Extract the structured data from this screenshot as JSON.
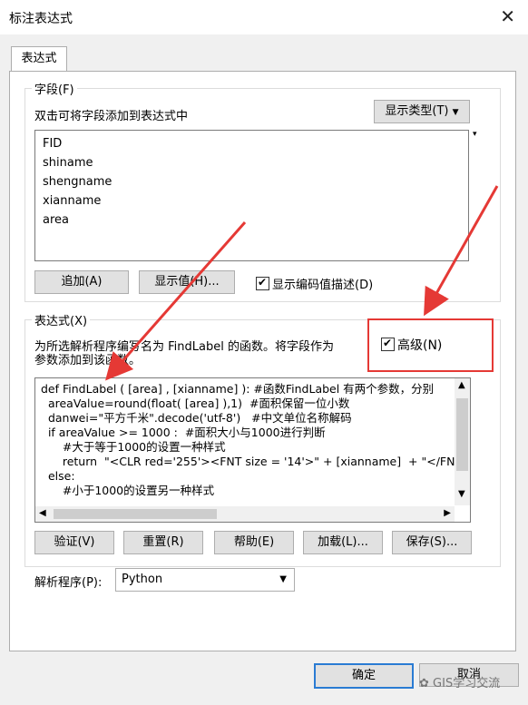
{
  "window": {
    "title": "标注表达式",
    "close_label": "✕"
  },
  "tabs": [
    {
      "label": "表达式"
    }
  ],
  "fields_group": {
    "legend": "字段(F)",
    "instruction": "双击可将字段添加到表达式中",
    "show_type_label": "显示类型(T)",
    "fields": [
      "FID",
      "shiname",
      "shengname",
      "xianname",
      "area"
    ],
    "append_label": "追加(A)",
    "show_values_label": "显示值(H)...",
    "show_coded_label": "显示编码值描述(D)",
    "show_coded_checked": true
  },
  "expression_group": {
    "legend": "表达式(X)",
    "description_line1": "为所选解析程序编写名为 FindLabel 的函数。将字段作为",
    "description_line2": "参数添加到该函数。",
    "advanced_label": "高级(N)",
    "advanced_checked": true,
    "code_lines": [
      "def FindLabel ( [area] , [xianname] ): #函数FindLabel 有两个参数，分别",
      "  areaValue=round(float( [area] ),1)  #面积保留一位小数",
      "  danwei=\"平方千米\".decode('utf-8')   #中文单位名称解码",
      "  if areaValue >= 1000 :  #面积大小与1000进行判断",
      "      #大于等于1000的设置一种样式",
      "      return  \"<CLR red='255'><FNT size = '14'>\" + [xianname]  + \"</FNT",
      "  else:",
      "      #小于1000的设置另一种样式"
    ],
    "verify_label": "验证(V)",
    "reset_label": "重置(R)",
    "help_label": "帮助(E)",
    "load_label": "加载(L)...",
    "save_label": "保存(S)..."
  },
  "parser": {
    "label": "解析程序(P):",
    "value": "Python"
  },
  "footer": {
    "ok_label": "确定",
    "cancel_label": "取消"
  },
  "watermark": {
    "text": "GIS学习交流"
  },
  "colors": {
    "annotation_red": "#e53935",
    "focus_blue": "#2a7bd3"
  }
}
